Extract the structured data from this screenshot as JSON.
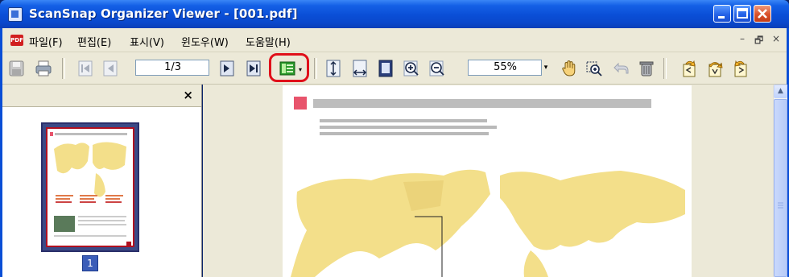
{
  "window": {
    "title": "ScanSnap Organizer Viewer - [001.pdf]",
    "controls": [
      "minimize",
      "maximize",
      "close"
    ]
  },
  "menubar": {
    "items": [
      {
        "label": "파일(F)"
      },
      {
        "label": "편집(E)"
      },
      {
        "label": "표시(V)"
      },
      {
        "label": "윈도우(W)"
      },
      {
        "label": "도움말(H)"
      }
    ],
    "mdi_controls": [
      "–",
      "🗗",
      "×"
    ]
  },
  "toolbar": {
    "page_value": "1/3",
    "zoom_value": "55%",
    "highlighted_button": "thumbnail-toggle",
    "highlight_color": "#e0101a"
  },
  "thumbnail_pane": {
    "close_label": "×",
    "pages": [
      {
        "number": "1",
        "selected": true
      }
    ]
  },
  "colors": {
    "titlebar": "#0a4ed6",
    "chrome": "#ece9d8",
    "map": "#f3df8a",
    "heading_accent": "#e8546c"
  }
}
